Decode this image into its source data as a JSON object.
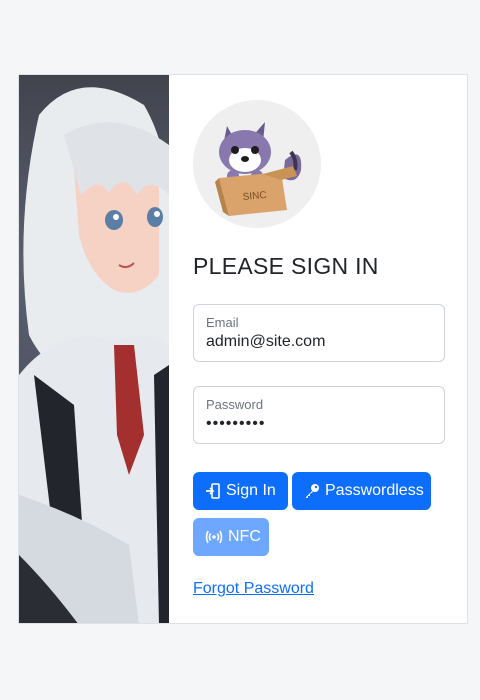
{
  "form": {
    "title": "PLEASE SIGN IN",
    "email": {
      "label": "Email",
      "value": "admin@site.com"
    },
    "password": {
      "label": "Password",
      "value": "•••••••••"
    }
  },
  "buttons": {
    "sign_in": "Sign In",
    "passwordless": "Passwordless",
    "nfc": "NFC"
  },
  "links": {
    "forgot_password": "Forgot Password"
  },
  "logo": {
    "text": "SINC"
  },
  "colors": {
    "primary": "#0d6efd",
    "primary_disabled": "#6ea8fe",
    "page_bg": "#f5f6f8"
  }
}
